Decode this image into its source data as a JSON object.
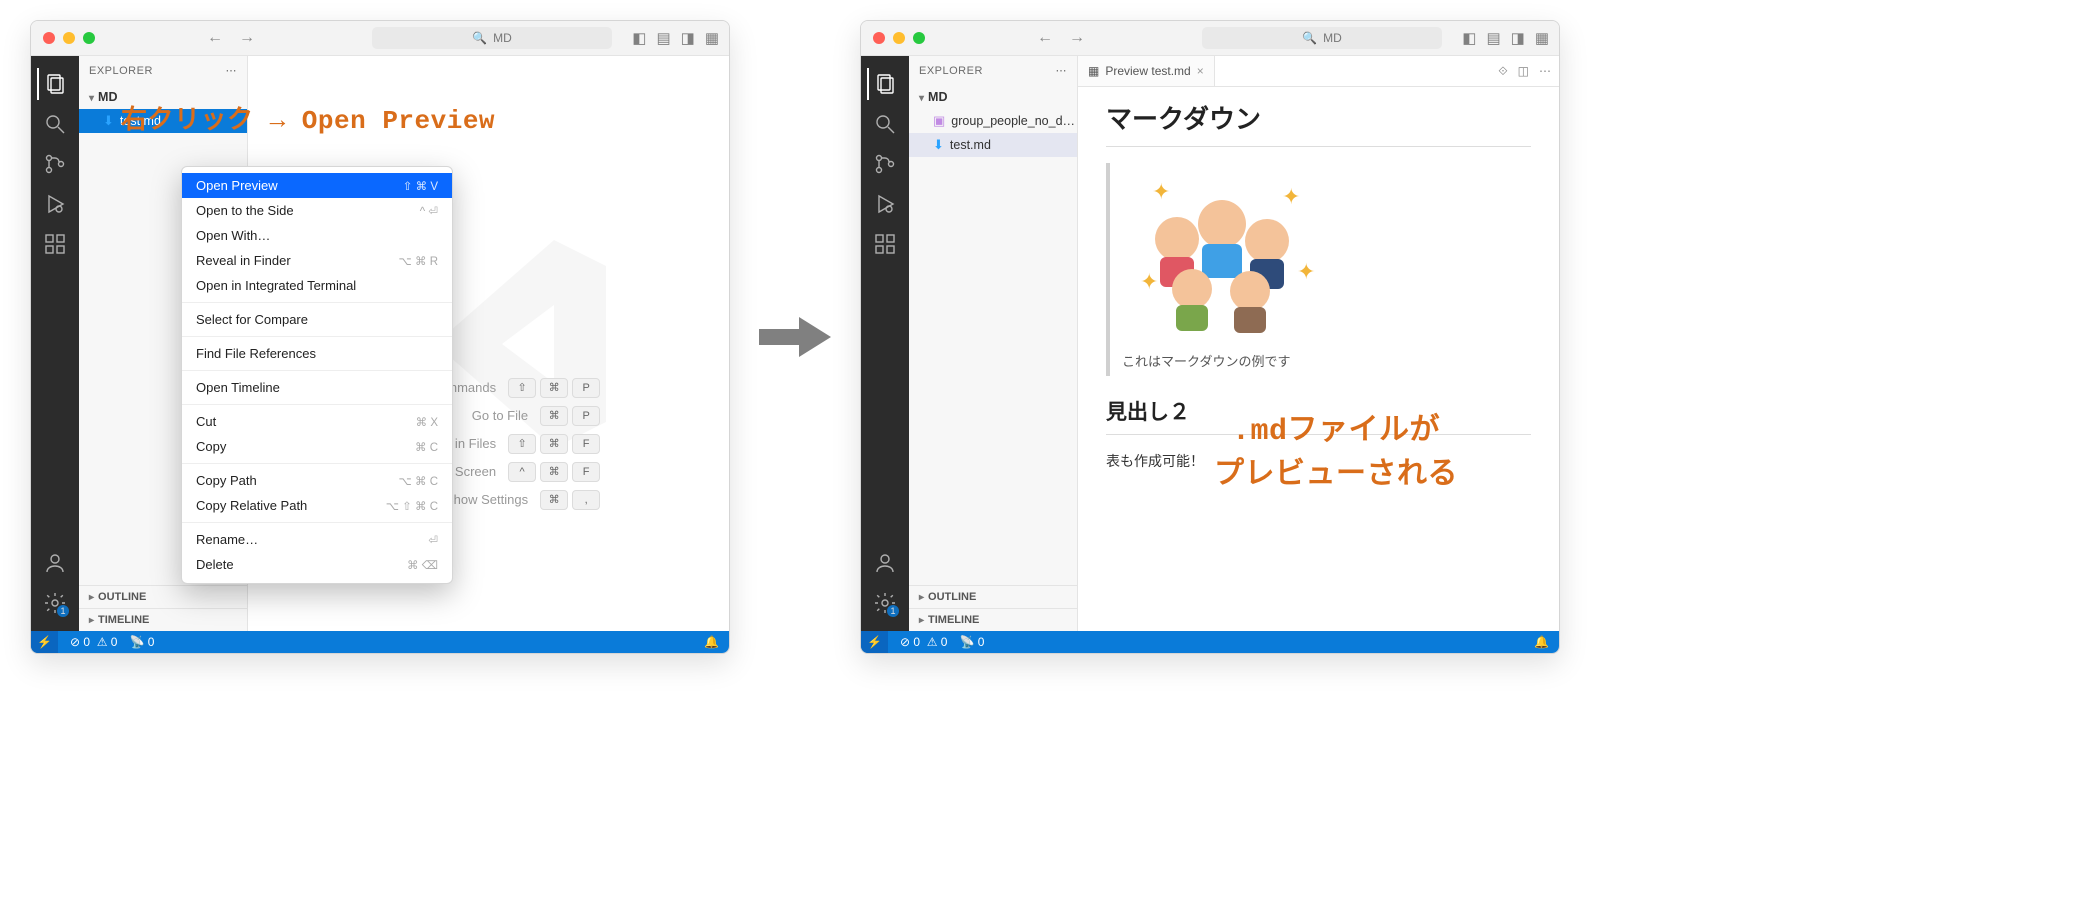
{
  "titlebar": {
    "search_placeholder": "MD"
  },
  "explorer": {
    "label": "EXPLORER",
    "root": "MD",
    "outline": "OUTLINE",
    "timeline": "TIMELINE",
    "files_left": [
      {
        "icon": "down",
        "name": "test.md"
      }
    ],
    "files_right": [
      {
        "icon": "img",
        "name": "group_people_no_d…"
      },
      {
        "icon": "down",
        "name": "test.md"
      }
    ]
  },
  "welcome": {
    "rows": [
      {
        "label": "Show all Commands",
        "keys": [
          "⇧",
          "⌘",
          "P"
        ]
      },
      {
        "label": "Go to File",
        "keys": [
          "⌘",
          "P"
        ]
      },
      {
        "label": "Find in Files",
        "keys": [
          "⇧",
          "⌘",
          "F"
        ]
      },
      {
        "label": "Toggle Full Screen",
        "keys": [
          "^",
          "⌘",
          "F"
        ]
      },
      {
        "label": "Show Settings",
        "keys": [
          "⌘",
          ","
        ]
      }
    ]
  },
  "ctx": {
    "items": [
      {
        "label": "Open Preview",
        "shortcut": "⇧ ⌘ V",
        "selected": true
      },
      {
        "label": "Open to the Side",
        "shortcut": "^ ⏎"
      },
      {
        "label": "Open With…",
        "shortcut": ""
      },
      {
        "label": "Reveal in Finder",
        "shortcut": "⌥ ⌘ R"
      },
      {
        "label": "Open in Integrated Terminal",
        "shortcut": ""
      },
      {
        "sep": true
      },
      {
        "label": "Select for Compare",
        "shortcut": ""
      },
      {
        "sep": true
      },
      {
        "label": "Find File References",
        "shortcut": ""
      },
      {
        "sep": true
      },
      {
        "label": "Open Timeline",
        "shortcut": ""
      },
      {
        "sep": true
      },
      {
        "label": "Cut",
        "shortcut": "⌘ X"
      },
      {
        "label": "Copy",
        "shortcut": "⌘ C"
      },
      {
        "sep": true
      },
      {
        "label": "Copy Path",
        "shortcut": "⌥ ⌘ C"
      },
      {
        "label": "Copy Relative Path",
        "shortcut": "⌥ ⇧ ⌘ C"
      },
      {
        "sep": true
      },
      {
        "label": "Rename…",
        "shortcut": "⏎"
      },
      {
        "label": "Delete",
        "shortcut": "⌘ ⌫"
      }
    ]
  },
  "preview_tab": {
    "label": "Preview test.md"
  },
  "md": {
    "h1": "マークダウン",
    "caption": "これはマークダウンの例です",
    "h2": "見出し２",
    "note": "表も作成可能！"
  },
  "status": {
    "errors": "0",
    "warnings": "0",
    "port": "0"
  },
  "annotations": {
    "a1": "右クリック → Open Preview",
    "a2_line1": ".mdファイルが",
    "a2_line2": "プレビューされる"
  },
  "gear_badge": "1"
}
